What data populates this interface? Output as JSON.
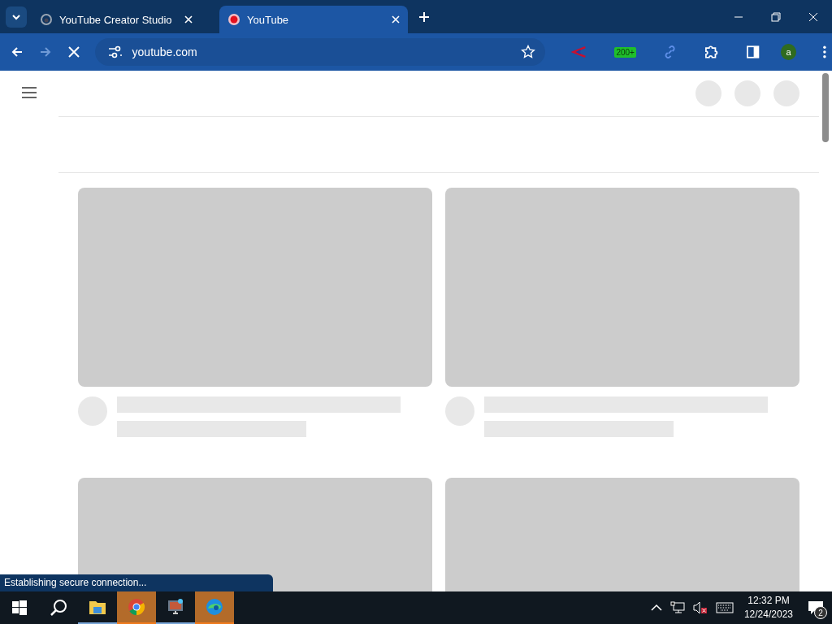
{
  "browser": {
    "tabs": [
      {
        "title": "YouTube Creator Studio",
        "kind": "studio",
        "selected": false
      },
      {
        "title": "YouTube",
        "kind": "youtube",
        "selected": true
      }
    ],
    "address": "youtube.com",
    "loading": true,
    "extension_badge": "200+",
    "profile_initial": "a"
  },
  "page": {
    "feed": [
      {
        "kind": "skeleton"
      },
      {
        "kind": "skeleton"
      },
      {
        "kind": "skeleton_cut"
      },
      {
        "kind": "skeleton_cut"
      }
    ]
  },
  "status_bubble": "Establishing secure connection...",
  "taskbar": {
    "apps": [
      {
        "kind": "explorer",
        "highlighted": false
      },
      {
        "kind": "chrome",
        "highlighted": true
      },
      {
        "kind": "monitor",
        "highlighted": false
      },
      {
        "kind": "edge",
        "highlighted": true
      }
    ],
    "time": "12:32 PM",
    "date": "12/24/2023",
    "notifications": "2"
  }
}
